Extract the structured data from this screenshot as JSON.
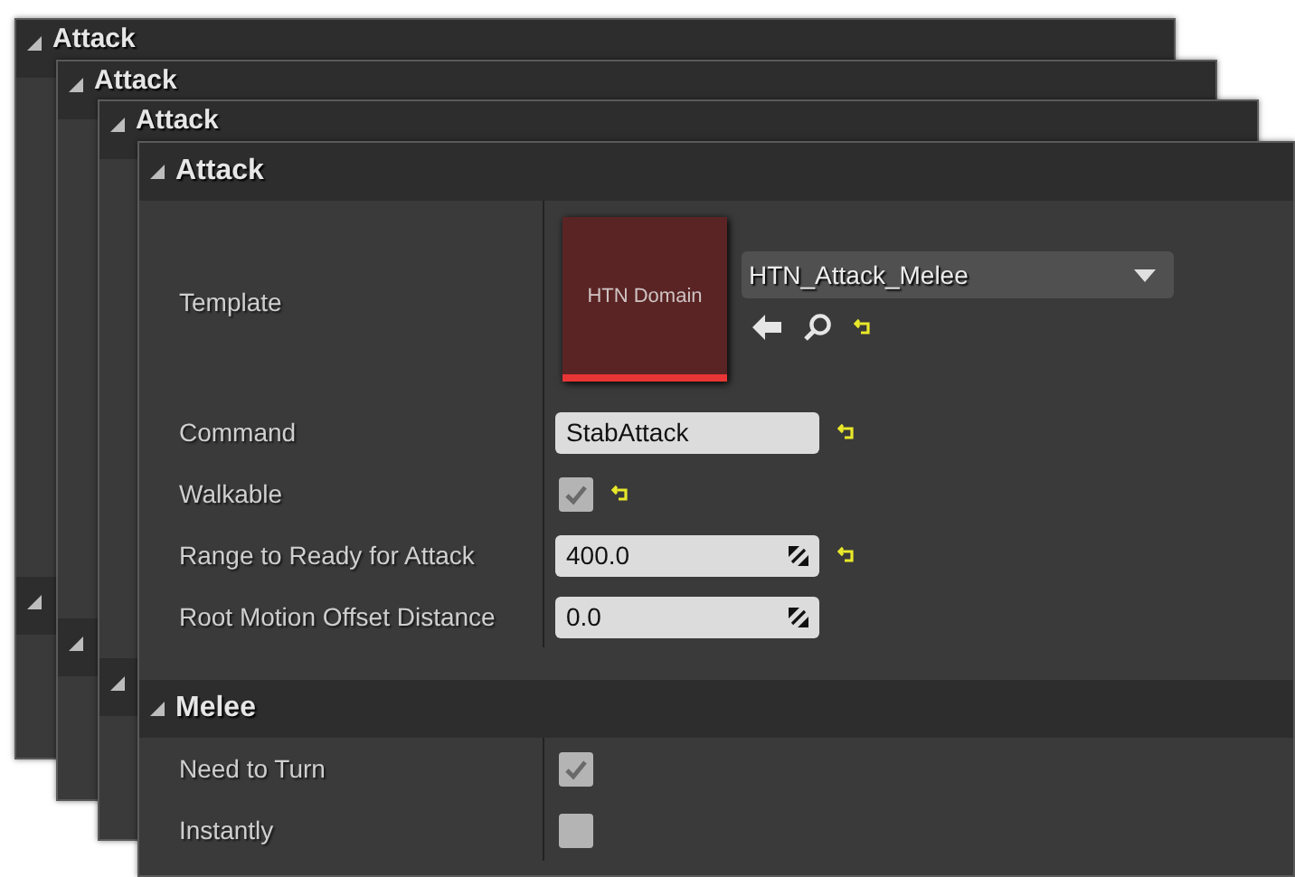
{
  "back_panels": [
    {
      "title": "Attack"
    },
    {
      "title": "Attack"
    },
    {
      "title": "Attack"
    }
  ],
  "panel": {
    "sections": [
      {
        "title": "Attack",
        "expanded": true,
        "properties": [
          {
            "kind": "asset",
            "label": "Template",
            "thumbnail_label": "HTN Domain",
            "value": "HTN_Attack_Melee",
            "reset": true
          },
          {
            "kind": "text",
            "label": "Command",
            "value": "StabAttack",
            "reset": true
          },
          {
            "kind": "checkbox",
            "label": "Walkable",
            "checked": true,
            "reset": true
          },
          {
            "kind": "number",
            "label": "Range to Ready for Attack",
            "value": "400.0",
            "reset": true
          },
          {
            "kind": "number",
            "label": "Root Motion Offset Distance",
            "value": "0.0",
            "reset": false
          }
        ]
      },
      {
        "title": "Melee",
        "expanded": true,
        "properties": [
          {
            "kind": "checkbox",
            "label": "Need to Turn",
            "checked": true,
            "reset": false
          },
          {
            "kind": "checkbox",
            "label": "Instantly",
            "checked": false,
            "reset": false
          }
        ]
      }
    ]
  }
}
